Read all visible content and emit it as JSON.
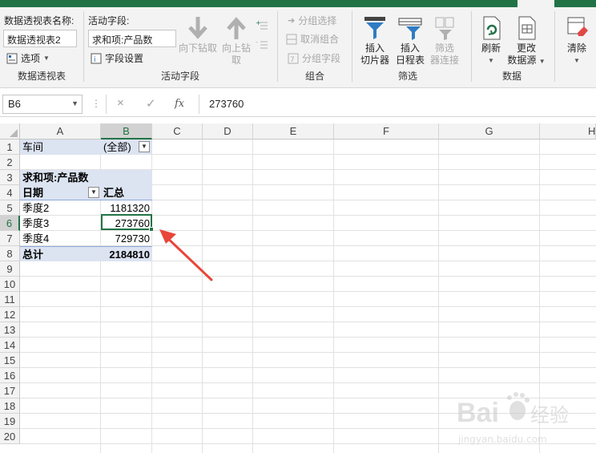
{
  "ribbon": {
    "pivot_group": {
      "name_label": "数据透视表名称:",
      "name_value": "数据透视表2",
      "options_label": "选项",
      "group_label": "数据透视表"
    },
    "active_field_group": {
      "field_label": "活动字段:",
      "field_value": "求和项:产品数",
      "field_settings_label": "字段设置",
      "drill_down_label_1": "向下钻取",
      "drill_up_label_1": "向上钻",
      "drill_up_label_2": "取",
      "group_label": "活动字段"
    },
    "group_group": {
      "group_selection_label": "分组选择",
      "ungroup_label": "取消组合",
      "group_field_label": "分组字段",
      "group_label": "组合"
    },
    "filter_group": {
      "slicer_label_1": "插入",
      "slicer_label_2": "切片器",
      "timeline_label_1": "插入",
      "timeline_label_2": "日程表",
      "filter_conn_label_1": "筛选",
      "filter_conn_label_2": "器连接",
      "group_label": "筛选"
    },
    "data_group": {
      "refresh_label": "刷新",
      "change_source_label_1": "更改",
      "change_source_label_2": "数据源",
      "group_label": "数据"
    },
    "clear_label": "清除"
  },
  "formula_bar": {
    "name_box": "B6",
    "cancel_icon": "×",
    "confirm_icon": "✓",
    "fx_label": "fx",
    "formula_value": "273760"
  },
  "columns": [
    "A",
    "B",
    "C",
    "D",
    "E",
    "F",
    "G",
    "H"
  ],
  "rows": [
    "1",
    "2",
    "3",
    "4",
    "5",
    "6",
    "7",
    "8",
    "9",
    "10",
    "11",
    "12",
    "13",
    "14",
    "15",
    "16",
    "17",
    "18",
    "19",
    "20"
  ],
  "pivot": {
    "filter_field": "车间",
    "filter_value": "(全部)",
    "value_header": "求和项:产品数",
    "row_label": "日期",
    "sum_label": "汇总",
    "rows": [
      {
        "label": "季度2",
        "value": "1181320"
      },
      {
        "label": "季度3",
        "value": "273760"
      },
      {
        "label": "季度4",
        "value": "729730"
      }
    ],
    "total_label": "总计",
    "total_value": "2184810"
  },
  "colors": {
    "accent_green": "#217346",
    "pivot_fill": "#dce3f1",
    "arrow_red": "#e8463a"
  },
  "watermark": {
    "brand": "Bai",
    "suffix": "经验",
    "url": "jingyan.baidu.com"
  }
}
